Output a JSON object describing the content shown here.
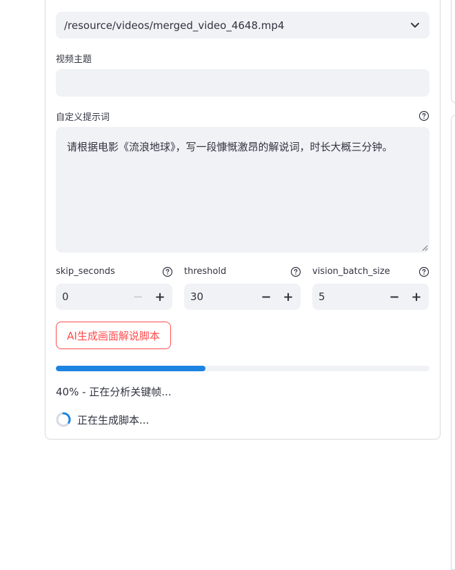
{
  "video_select": {
    "value": "/resource/videos/merged_video_4648.mp4",
    "icon": "chevron-down-icon"
  },
  "video_topic": {
    "label": "视频主题",
    "value": ""
  },
  "custom_prompt": {
    "label": "自定义提示词",
    "value": "请根据电影《流浪地球》，写一段慷慨激昂的解说词，时长大概三分钟。",
    "help_icon": "help-circle-icon"
  },
  "number_inputs": [
    {
      "label": "skip_seconds",
      "value": "0",
      "minus_disabled": true
    },
    {
      "label": "threshold",
      "value": "30",
      "minus_disabled": false
    },
    {
      "label": "vision_batch_size",
      "value": "5",
      "minus_disabled": false
    }
  ],
  "stepper": {
    "minus": "−",
    "plus": "+"
  },
  "ai_button": {
    "label": "AI生成画面解说脚本"
  },
  "progress": {
    "percent": 40,
    "text": "40% - 正在分析关键帧..."
  },
  "status": {
    "text": "正在生成脚本..."
  },
  "colors": {
    "accent": "#ff4b4b",
    "progress": "#1c83e1",
    "input_bg": "#f0f2f6"
  }
}
